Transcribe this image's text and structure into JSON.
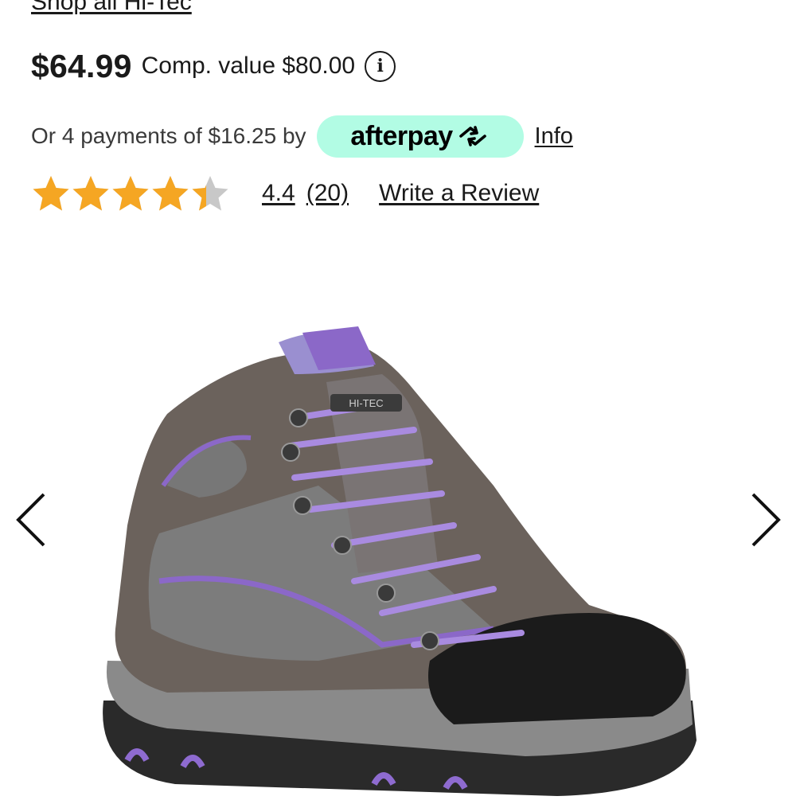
{
  "brand_link": "Shop all Hi-Tec",
  "pricing": {
    "price": "$64.99",
    "comp_value": "Comp. value $80.00",
    "info_icon": "info-circle-icon"
  },
  "afterpay": {
    "text": "Or 4 payments of $16.25 by",
    "badge_label": "afterpay",
    "badge_color": "#b2fce4",
    "info_link": "Info"
  },
  "rating": {
    "stars_filled": 4.4,
    "stars_total": 5,
    "star_color": "#f5a623",
    "empty_star_color": "#c8c8c8",
    "value": "4.4",
    "count": "(20)",
    "write_review": "Write a Review"
  },
  "gallery": {
    "prev_icon": "chevron-left-icon",
    "next_icon": "chevron-right-icon",
    "image_alt": "Hi-Tec hiking boot",
    "image_logo": "HI-TEC"
  }
}
